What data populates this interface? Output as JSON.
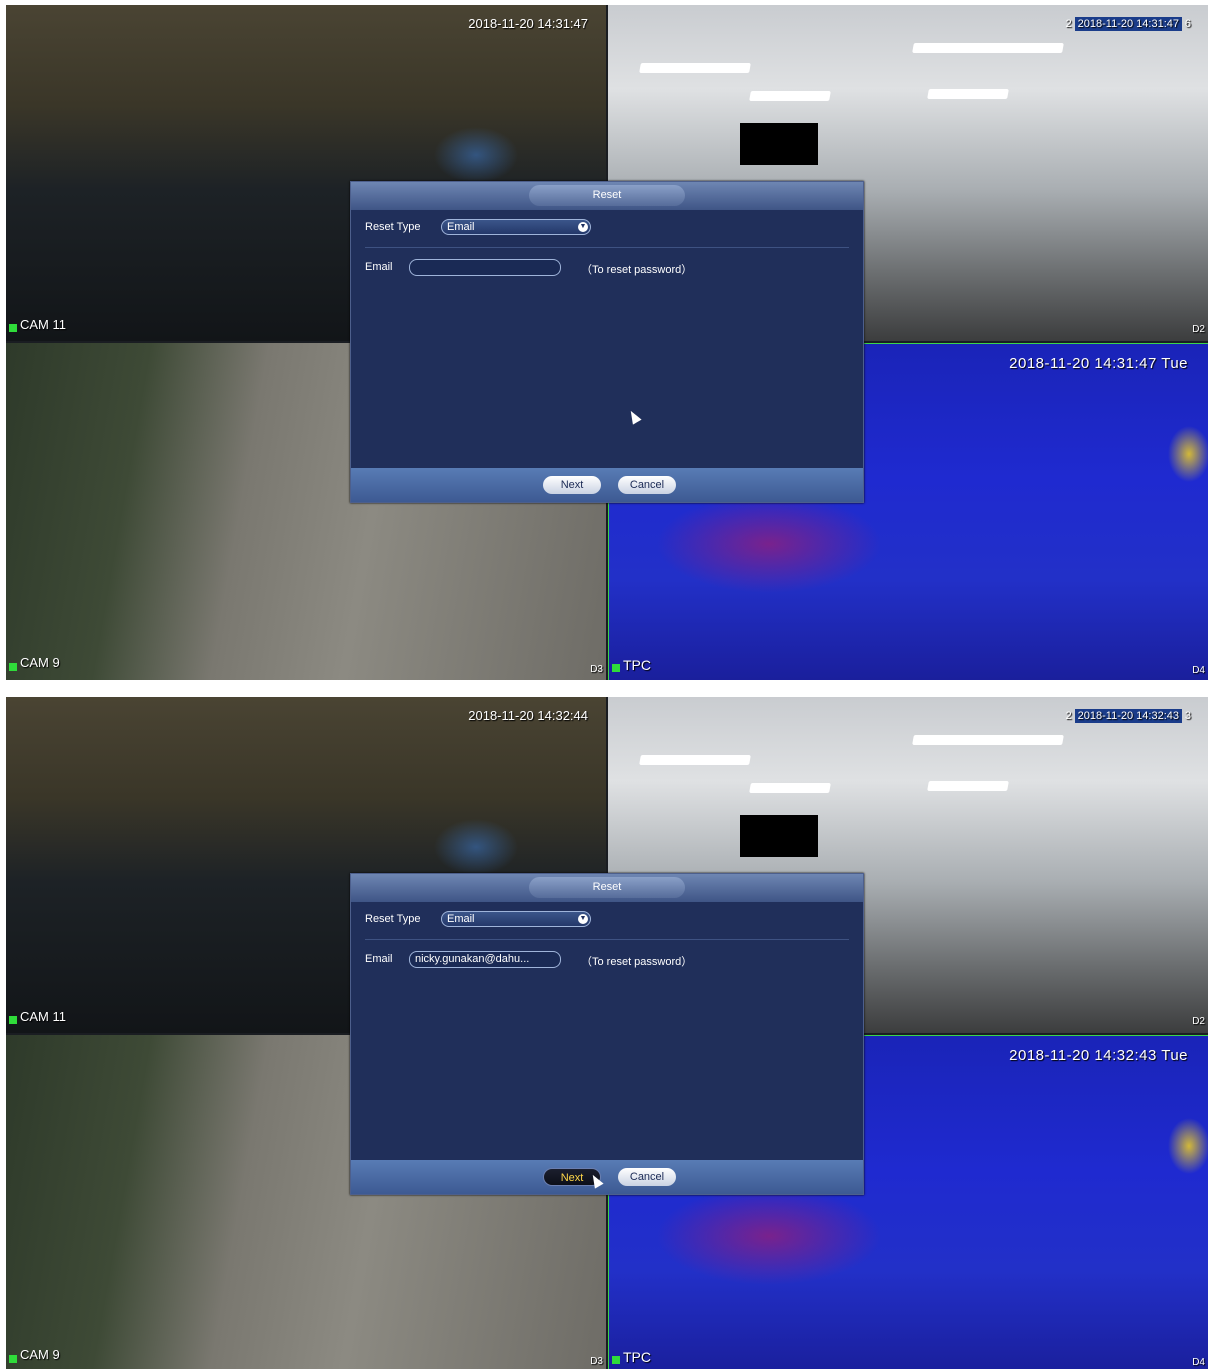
{
  "screenshots": [
    {
      "cameras": {
        "top_left": {
          "timestamp": "2018-11-20 14:31:47",
          "name": "CAM 11"
        },
        "top_right": {
          "timestamp_prefix": "2",
          "timestamp": "2018-11-20 14:31:47",
          "timestamp_suffix": "6",
          "corner": "D2"
        },
        "bottom_left": {
          "name": "CAM 9",
          "corner": "D3"
        },
        "bottom_right": {
          "timestamp": "2018-11-20 14:31:47 Tue",
          "name": "TPC",
          "corner": "D4"
        }
      },
      "dialog": {
        "title": "Reset",
        "reset_type_label": "Reset Type",
        "reset_type_value": "Email",
        "email_label": "Email",
        "email_value": "",
        "hint": "（To reset password）",
        "next_label": "Next",
        "cancel_label": "Cancel"
      }
    },
    {
      "cameras": {
        "top_left": {
          "timestamp": "2018-11-20 14:32:44",
          "name": "CAM 11"
        },
        "top_right": {
          "timestamp_prefix": "2",
          "timestamp": "2018-11-20 14:32:43",
          "timestamp_suffix": "3",
          "corner": "D2"
        },
        "bottom_left": {
          "name": "CAM 9",
          "corner": "D3"
        },
        "bottom_right": {
          "timestamp": "2018-11-20 14:32:43 Tue",
          "name": "TPC",
          "corner": "D4"
        }
      },
      "dialog": {
        "title": "Reset",
        "reset_type_label": "Reset Type",
        "reset_type_value": "Email",
        "email_label": "Email",
        "email_value": "nicky.gunakan@dahu...",
        "hint": "（To reset password）",
        "next_label": "Next",
        "cancel_label": "Cancel"
      }
    }
  ],
  "icons": {
    "dropdown": "chevron-down-icon",
    "cursor": "mouse-pointer-icon",
    "recording": "recording-indicator-icon"
  },
  "colors": {
    "dialog_bg": "#202f5a",
    "header": "#5a72a3",
    "recording": "#2fdc3a",
    "active_button_text": "#ffd84a"
  }
}
